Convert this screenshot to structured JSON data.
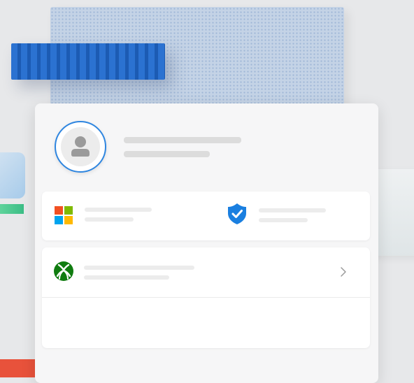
{
  "profile": {
    "avatar_icon": "person-icon",
    "name_placeholder": "",
    "email_placeholder": ""
  },
  "services": {
    "microsoft": {
      "icon": "microsoft-logo-icon",
      "colors": [
        "#f25022",
        "#7fba00",
        "#00a4ef",
        "#ffb900"
      ]
    },
    "security": {
      "icon": "shield-check-icon",
      "color": "#1a7fe0"
    }
  },
  "xbox": {
    "icon": "xbox-logo-icon",
    "color": "#107c10",
    "chevron": "chevron-right-icon"
  },
  "accent": "#2f86e0"
}
